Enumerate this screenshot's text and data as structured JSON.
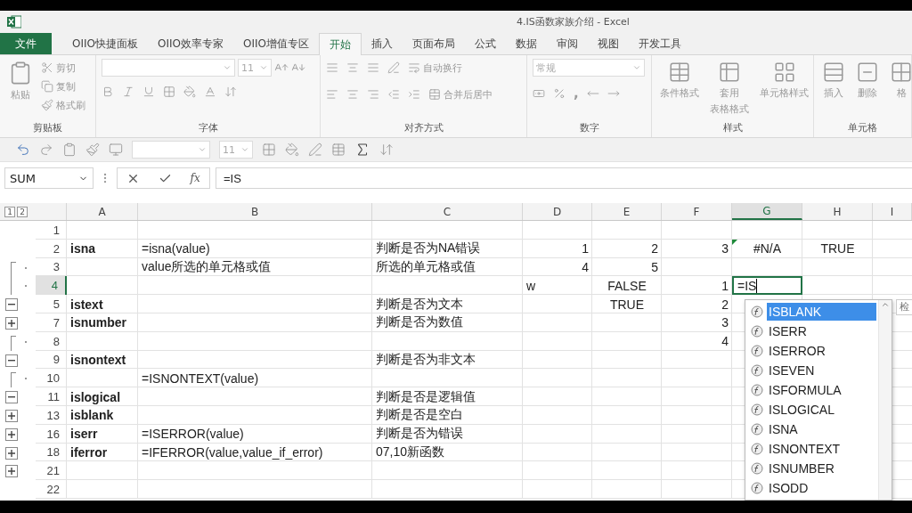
{
  "window": {
    "title": "4.IS函数家族介绍 - Excel"
  },
  "tabs": [
    {
      "label": "文件",
      "kind": "file",
      "selected": false
    },
    {
      "label": "OIIO快捷面板",
      "kind": "tab",
      "selected": false
    },
    {
      "label": "OIIO效率专家",
      "kind": "tab",
      "selected": false
    },
    {
      "label": "OIIO增值专区",
      "kind": "tab",
      "selected": false
    },
    {
      "label": "开始",
      "kind": "tab",
      "selected": true
    },
    {
      "label": "插入",
      "kind": "tab",
      "selected": false
    },
    {
      "label": "页面布局",
      "kind": "tab",
      "selected": false
    },
    {
      "label": "公式",
      "kind": "tab",
      "selected": false
    },
    {
      "label": "数据",
      "kind": "tab",
      "selected": false
    },
    {
      "label": "审阅",
      "kind": "tab",
      "selected": false
    },
    {
      "label": "视图",
      "kind": "tab",
      "selected": false
    },
    {
      "label": "开发工具",
      "kind": "tab",
      "selected": false
    }
  ],
  "ribbon": {
    "disabled": true,
    "clipboard": {
      "label": "剪贴板",
      "paste": "粘贴",
      "cut": "剪切",
      "copy": "复制",
      "painter": "格式刷"
    },
    "font": {
      "label": "字体",
      "size": "11"
    },
    "alignment": {
      "label": "对齐方式",
      "wrap": "自动换行",
      "merge": "合并后居中"
    },
    "number": {
      "label": "数字",
      "format": "常规",
      "comma": ","
    },
    "styles": {
      "label": "样式",
      "conditional": "条件格式",
      "table": [
        "套用",
        "表格格式"
      ],
      "cell": "单元格样式"
    },
    "cells": {
      "label": "单元格",
      "insert": "插入",
      "delete": "删除",
      "format": "格"
    }
  },
  "quick_toolbar": {
    "font_size": "11"
  },
  "formula_bar": {
    "name_box": "SUM",
    "fx": "fx",
    "value": "=IS"
  },
  "sheet": {
    "levels": [
      "1",
      "2"
    ],
    "columns": [
      "A",
      "B",
      "C",
      "D",
      "E",
      "F",
      "G",
      "H",
      "I"
    ],
    "rows": [
      {
        "n": "1",
        "kind": "plain",
        "cells": {}
      },
      {
        "n": "2",
        "kind": "plain",
        "cells": {
          "A": {
            "text": "isna",
            "kind": "heading"
          },
          "B": {
            "text": "=isna(value)",
            "kind": "text"
          },
          "C": {
            "text": "判断是否为NA错误",
            "kind": "text"
          },
          "D": {
            "text": "1",
            "kind": "number"
          },
          "E": {
            "text": "2",
            "kind": "number"
          },
          "F": {
            "text": "3",
            "kind": "number"
          },
          "G": {
            "text": "#N/A",
            "kind": "error",
            "error_flag": true
          },
          "H": {
            "text": "TRUE",
            "kind": "logical"
          }
        }
      },
      {
        "n": "3",
        "kind": "detail_start",
        "cells": {
          "B": {
            "text": "value所选的单元格或值",
            "kind": "text"
          },
          "C": {
            "text": "所选的单元格或值",
            "kind": "text"
          },
          "D": {
            "text": "4",
            "kind": "number"
          },
          "E": {
            "text": "5",
            "kind": "number"
          }
        }
      },
      {
        "n": "4",
        "kind": "detail",
        "cells": {
          "D": {
            "text": "w",
            "kind": "text"
          },
          "E": {
            "text": "FALSE",
            "kind": "logical"
          },
          "F": {
            "text": "1",
            "kind": "number"
          },
          "G": {
            "text": "=IS",
            "kind": "editing",
            "active": true
          }
        }
      },
      {
        "n": "5",
        "kind": "collapse",
        "cells": {
          "A": {
            "text": "istext",
            "kind": "heading"
          },
          "C": {
            "text": "判断是否为文本",
            "kind": "text"
          },
          "E": {
            "text": "TRUE",
            "kind": "logical"
          },
          "F": {
            "text": "2",
            "kind": "number"
          }
        }
      },
      {
        "n": "7",
        "kind": "expand",
        "cells": {
          "A": {
            "text": "isnumber",
            "kind": "heading"
          },
          "C": {
            "text": "判断是否为数值",
            "kind": "text"
          },
          "F": {
            "text": "3",
            "kind": "number"
          }
        }
      },
      {
        "n": "8",
        "kind": "detail_start",
        "cells": {
          "F": {
            "text": "4",
            "kind": "number"
          }
        }
      },
      {
        "n": "9",
        "kind": "collapse",
        "cells": {
          "A": {
            "text": "isnontext",
            "kind": "heading"
          },
          "C": {
            "text": "判断是否为非文本",
            "kind": "text"
          }
        }
      },
      {
        "n": "10",
        "kind": "detail_start",
        "cells": {
          "B": {
            "text": "=ISNONTEXT(value)",
            "kind": "text"
          }
        }
      },
      {
        "n": "11",
        "kind": "collapse",
        "cells": {
          "A": {
            "text": "islogical",
            "kind": "heading"
          },
          "C": {
            "text": "判断是否是逻辑值",
            "kind": "text"
          }
        }
      },
      {
        "n": "13",
        "kind": "expand",
        "cells": {
          "A": {
            "text": "isblank",
            "kind": "heading"
          },
          "C": {
            "text": "判断是否是空白",
            "kind": "text"
          }
        }
      },
      {
        "n": "16",
        "kind": "expand",
        "cells": {
          "A": {
            "text": "iserr",
            "kind": "heading"
          },
          "B": {
            "text": "=ISERROR(value)",
            "kind": "text"
          },
          "C": {
            "text": "判断是否为错误",
            "kind": "text"
          }
        }
      },
      {
        "n": "18",
        "kind": "expand",
        "cells": {
          "A": {
            "text": "iferror",
            "kind": "heading"
          },
          "B": {
            "text": "=IFERROR(value,value_if_error)",
            "kind": "text"
          },
          "C": {
            "text": "07,10新函数",
            "kind": "text"
          }
        }
      },
      {
        "n": "21",
        "kind": "expand",
        "cells": {}
      },
      {
        "n": "22",
        "kind": "plain",
        "cells": {}
      }
    ]
  },
  "autocomplete": {
    "items": [
      {
        "label": "ISBLANK",
        "selected": true
      },
      {
        "label": "ISERR",
        "selected": false
      },
      {
        "label": "ISERROR",
        "selected": false
      },
      {
        "label": "ISEVEN",
        "selected": false
      },
      {
        "label": "ISFORMULA",
        "selected": false
      },
      {
        "label": "ISLOGICAL",
        "selected": false
      },
      {
        "label": "ISNA",
        "selected": false
      },
      {
        "label": "ISNONTEXT",
        "selected": false
      },
      {
        "label": "ISNUMBER",
        "selected": false
      },
      {
        "label": "ISODD",
        "selected": false
      }
    ],
    "tooltip": "检"
  }
}
